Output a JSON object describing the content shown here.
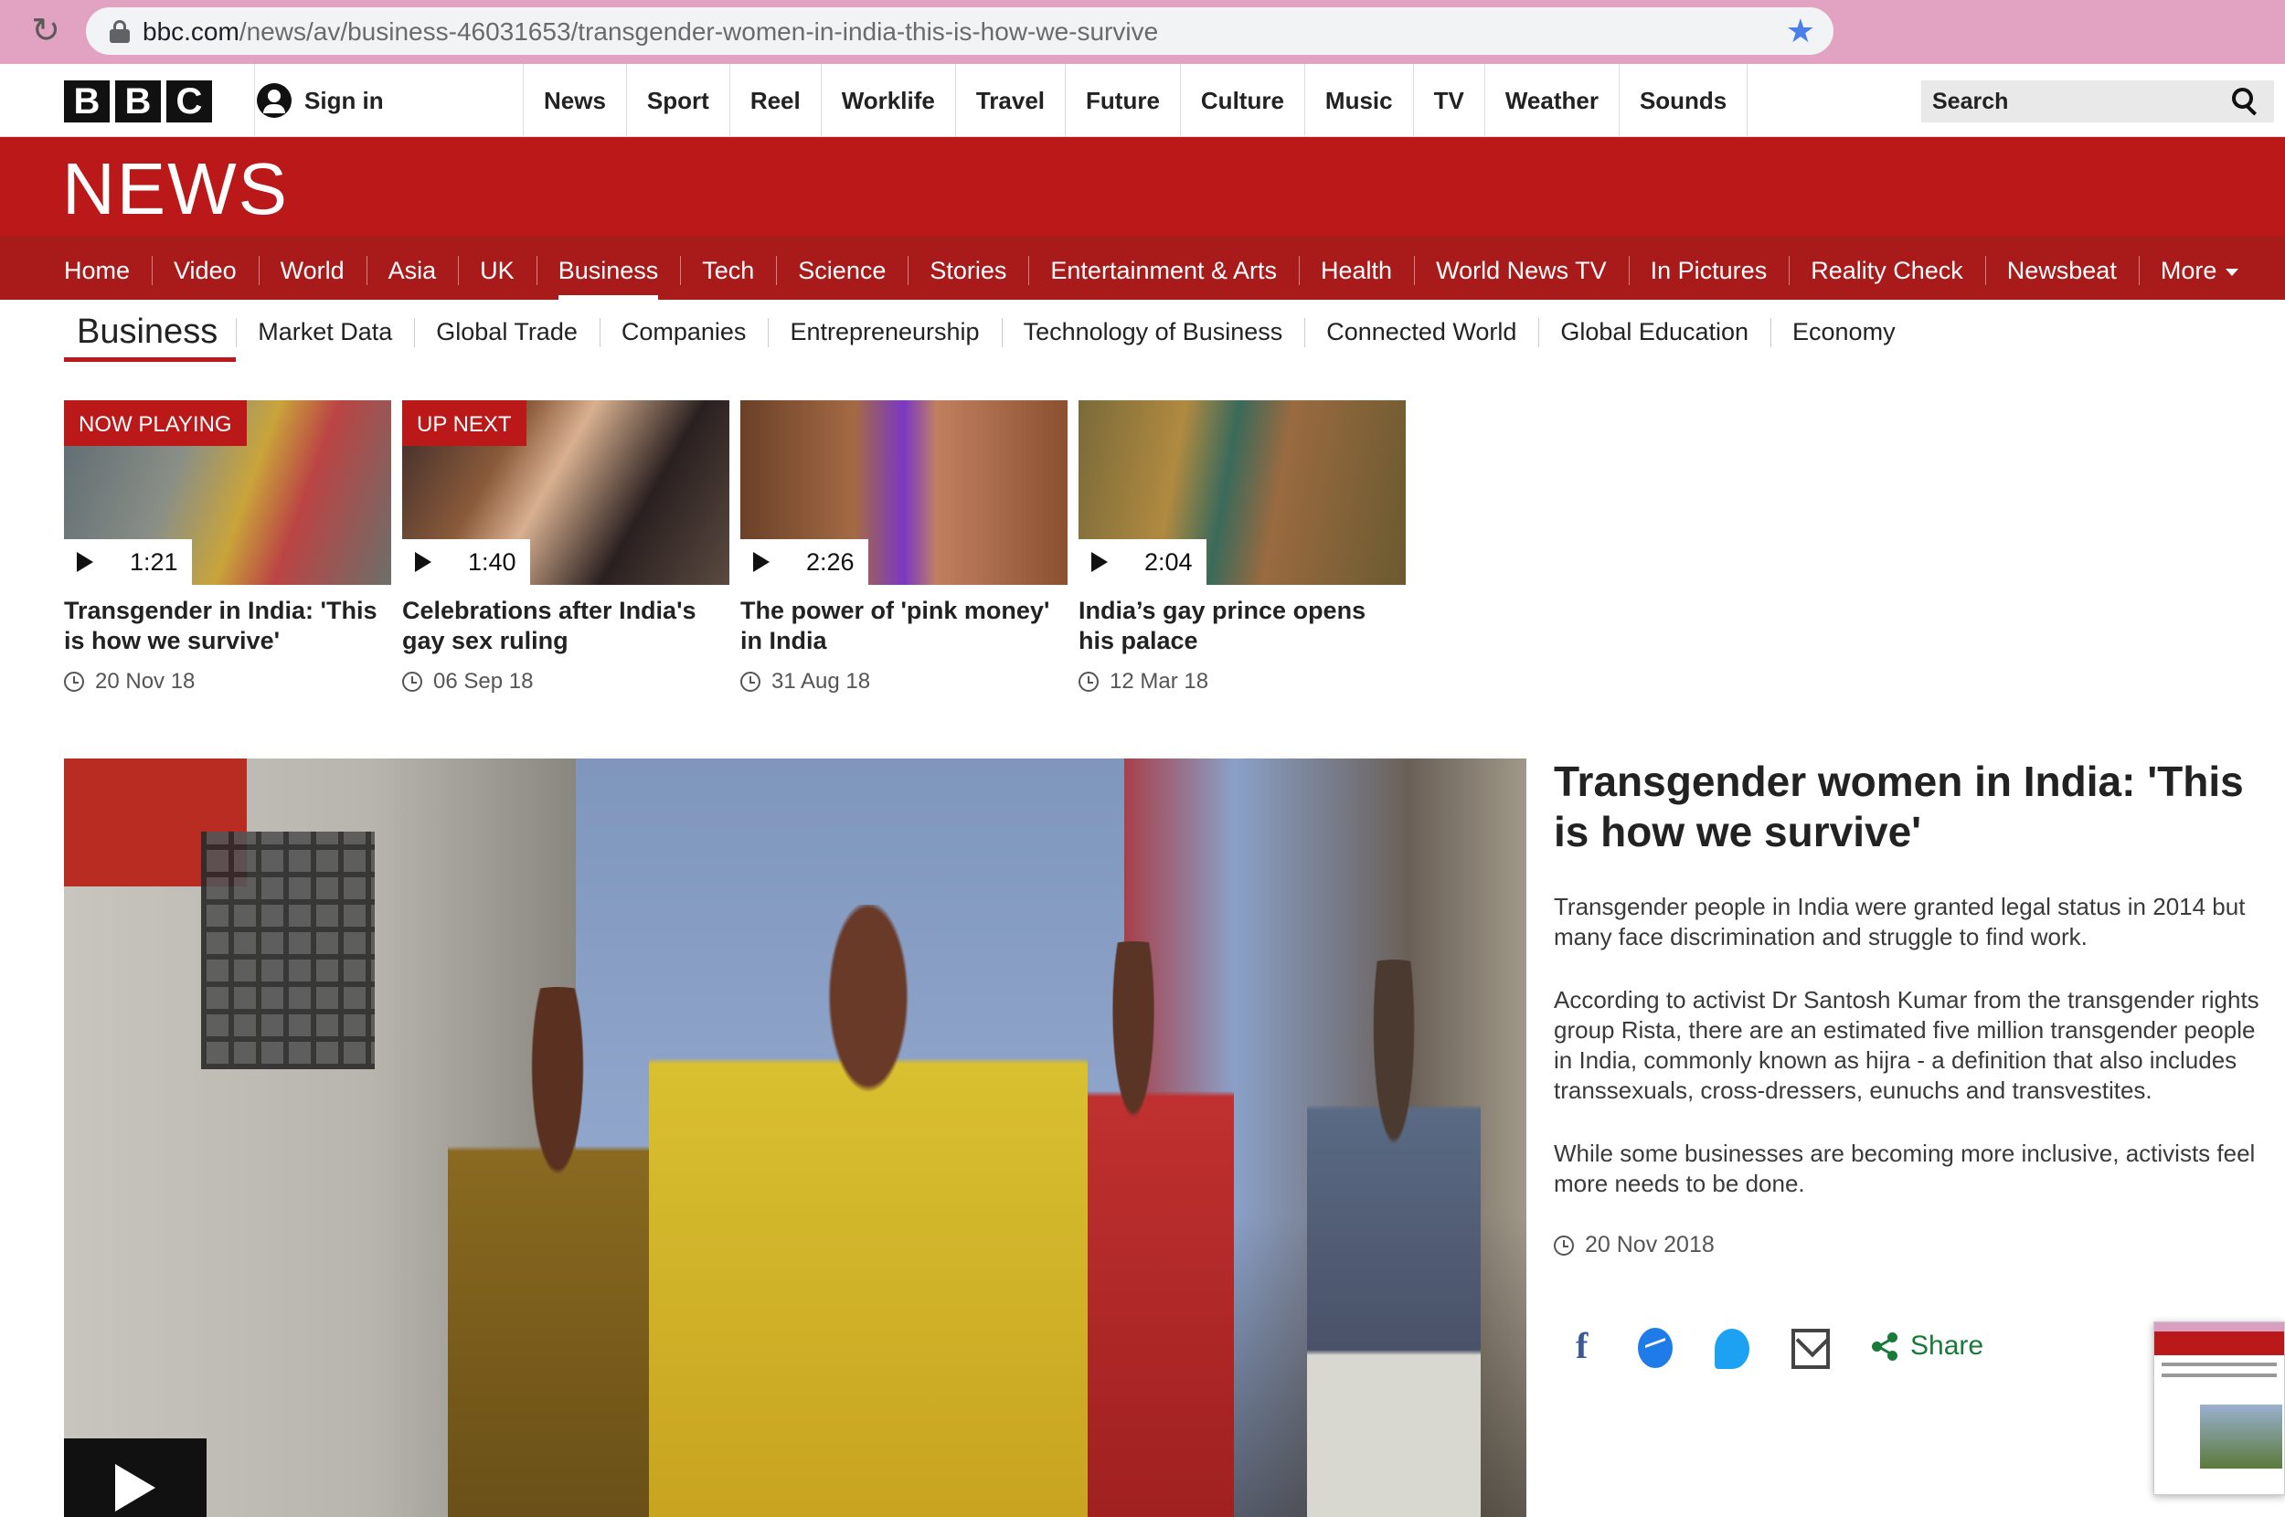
{
  "browser": {
    "url_host": "bbc.com",
    "url_path": "/news/av/business-46031653/transgender-women-in-india-this-is-how-we-survive"
  },
  "masthead": {
    "logo_letters": [
      "B",
      "B",
      "C"
    ],
    "sign_in": "Sign in",
    "nav": [
      "News",
      "Sport",
      "Reel",
      "Worklife",
      "Travel",
      "Future",
      "Culture",
      "Music",
      "TV",
      "Weather",
      "Sounds"
    ],
    "search_placeholder": "Search"
  },
  "news": {
    "title": "NEWS",
    "nav": [
      "Home",
      "Video",
      "World",
      "Asia",
      "UK",
      "Business",
      "Tech",
      "Science",
      "Stories",
      "Entertainment & Arts",
      "Health",
      "World News TV",
      "In Pictures",
      "Reality Check",
      "Newsbeat",
      "More"
    ],
    "active": "Business"
  },
  "subnav": {
    "section": "Business",
    "items": [
      "Market Data",
      "Global Trade",
      "Companies",
      "Entrepreneurship",
      "Technology of Business",
      "Connected World",
      "Global Education",
      "Economy"
    ]
  },
  "videos": [
    {
      "tag": "NOW PLAYING",
      "duration": "1:21",
      "title": "Transgender in India: 'This is how we survive'",
      "date": "20 Nov 18"
    },
    {
      "tag": "UP NEXT",
      "duration": "1:40",
      "title": "Celebrations after India's gay sex ruling",
      "date": "06 Sep 18"
    },
    {
      "tag": "",
      "duration": "2:26",
      "title": "The power of 'pink money' in India",
      "date": "31 Aug 18"
    },
    {
      "tag": "",
      "duration": "2:04",
      "title": "India’s gay prince opens his palace",
      "date": "12 Mar 18"
    }
  ],
  "article": {
    "headline": "Transgender women in India: 'This is how we survive'",
    "paragraphs": [
      "Transgender people in India were granted legal status in 2014 but many face discrimination and struggle to find work.",
      "According to activist Dr Santosh Kumar from the transgender rights group Rista, there are an estimated five million transgender people in India, commonly known as hijra - a definition that also includes transsexuals, cross-dressers, eunuchs and transvestites.",
      "While some businesses are becoming more inclusive, activists feel more needs to be done."
    ],
    "date": "20 Nov 2018",
    "share_label": "Share"
  },
  "colors": {
    "bbc_red": "#bb1919",
    "nav_red": "#a91a1a",
    "share_green": "#1a7a3a",
    "browser_bar": "#e2a2c2"
  }
}
